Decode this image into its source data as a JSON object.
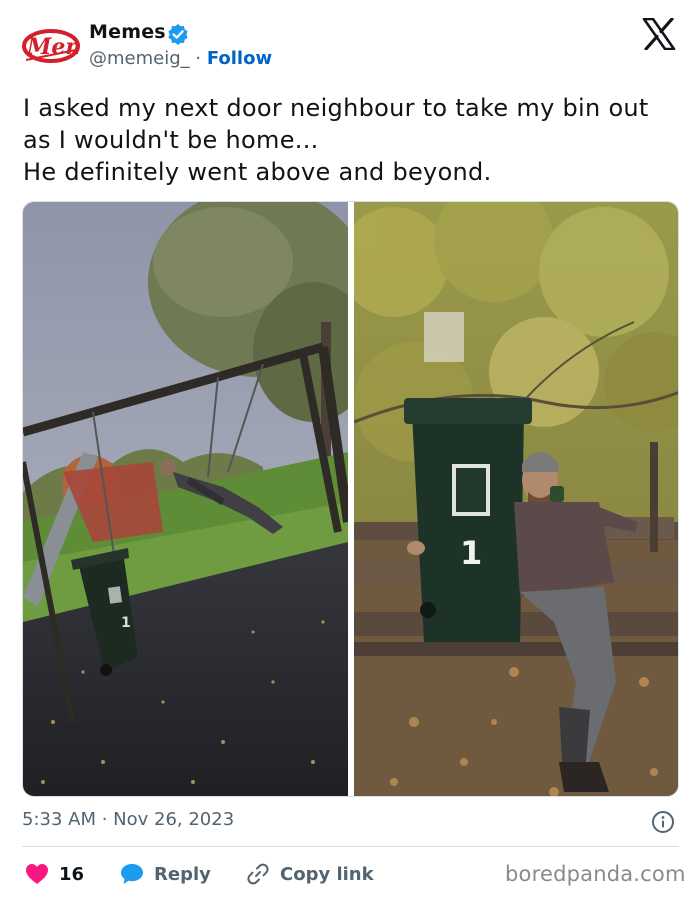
{
  "author": {
    "display_name": "Memes",
    "handle": "@memeig_",
    "separator": " · ",
    "follow_label": "Follow",
    "logo_text": "Meme"
  },
  "tweet": {
    "text_lines": [
      "I asked my next door neighbour to take my bin out",
      "as I wouldn't be home...",
      "He definitely went above and beyond."
    ],
    "timestamp": "5:33 AM · Nov 26, 2023"
  },
  "media": {
    "bin_number": "1"
  },
  "actions": {
    "like_count": "16",
    "reply_label": "Reply",
    "copy_link_label": "Copy link"
  },
  "watermark": "boredpanda.com",
  "colors": {
    "like": "#f91880",
    "reply": "#1d9bf0",
    "follow": "#0063c7",
    "verified": "#1d9bf0",
    "muted": "#536471"
  },
  "icons": {
    "avatar": "memes-logo-icon",
    "verified": "verified-badge-icon",
    "platform": "x-logo-icon",
    "info": "info-icon",
    "like": "heart-icon",
    "reply": "speech-bubble-icon",
    "copy": "link-icon"
  }
}
